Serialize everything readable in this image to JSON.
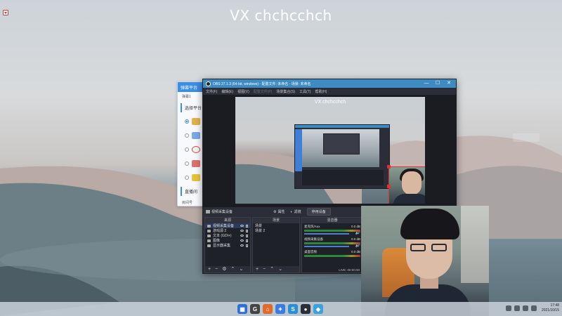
{
  "overlay_title": "VX chchcchch",
  "background_app": {
    "header": "弹幕平台",
    "tab": "弹幕1",
    "section_platform": "选择平台",
    "section_room": "直播间",
    "room_field_label": "房间号"
  },
  "obs": {
    "title": "OBS 27.1.3 (64-bit, windows) - 配置文件: 未命名 - 场景: 未命名",
    "menus": [
      "文件(F)",
      "编辑(E)",
      "视图(V)",
      "配置文件(P)",
      "场景集合(S)",
      "工具(T)",
      "帮助(H)"
    ],
    "preview_title": "VX chchcchch",
    "controls": {
      "source_name": "视频采集设备",
      "properties": "属性",
      "filters": "滤镜",
      "deactivate": "停用设备"
    },
    "docks": {
      "sources_header": "来源",
      "scenes_header": "场景",
      "mixer_header": "混音器",
      "sources": [
        "视频采集设备",
        "游戏源 2",
        "文本 (GDI+)",
        "图像",
        "显示器采集"
      ],
      "scenes": [
        "场景",
        "场景 2"
      ],
      "mixer_channels": [
        {
          "name": "麦克风/Aux",
          "db": "0.0 dB"
        },
        {
          "name": "视频采集设备",
          "db": "0.0 dB"
        },
        {
          "name": "桌面音频",
          "db": "0.0 dB"
        }
      ],
      "status": "LIVE: 00:00:00"
    },
    "window_buttons": [
      "—",
      "☐",
      "✕"
    ]
  },
  "taskbar": {
    "apps": [
      {
        "name": "start",
        "color": "#2f6fd6",
        "glyph": "▦"
      },
      {
        "name": "app-g",
        "color": "#444444",
        "glyph": "G"
      },
      {
        "name": "app-paper",
        "color": "#e06a2a",
        "glyph": "⌂"
      },
      {
        "name": "app-circle",
        "color": "#3c7be0",
        "glyph": "✦"
      },
      {
        "name": "app-s",
        "color": "#2a8fd8",
        "glyph": "S"
      },
      {
        "name": "obs",
        "color": "#2b2e38",
        "glyph": "●"
      },
      {
        "name": "app-tag",
        "color": "#3aa0e0",
        "glyph": "◆"
      }
    ],
    "clock_time": "17:48",
    "clock_date": "2021/10/15"
  }
}
